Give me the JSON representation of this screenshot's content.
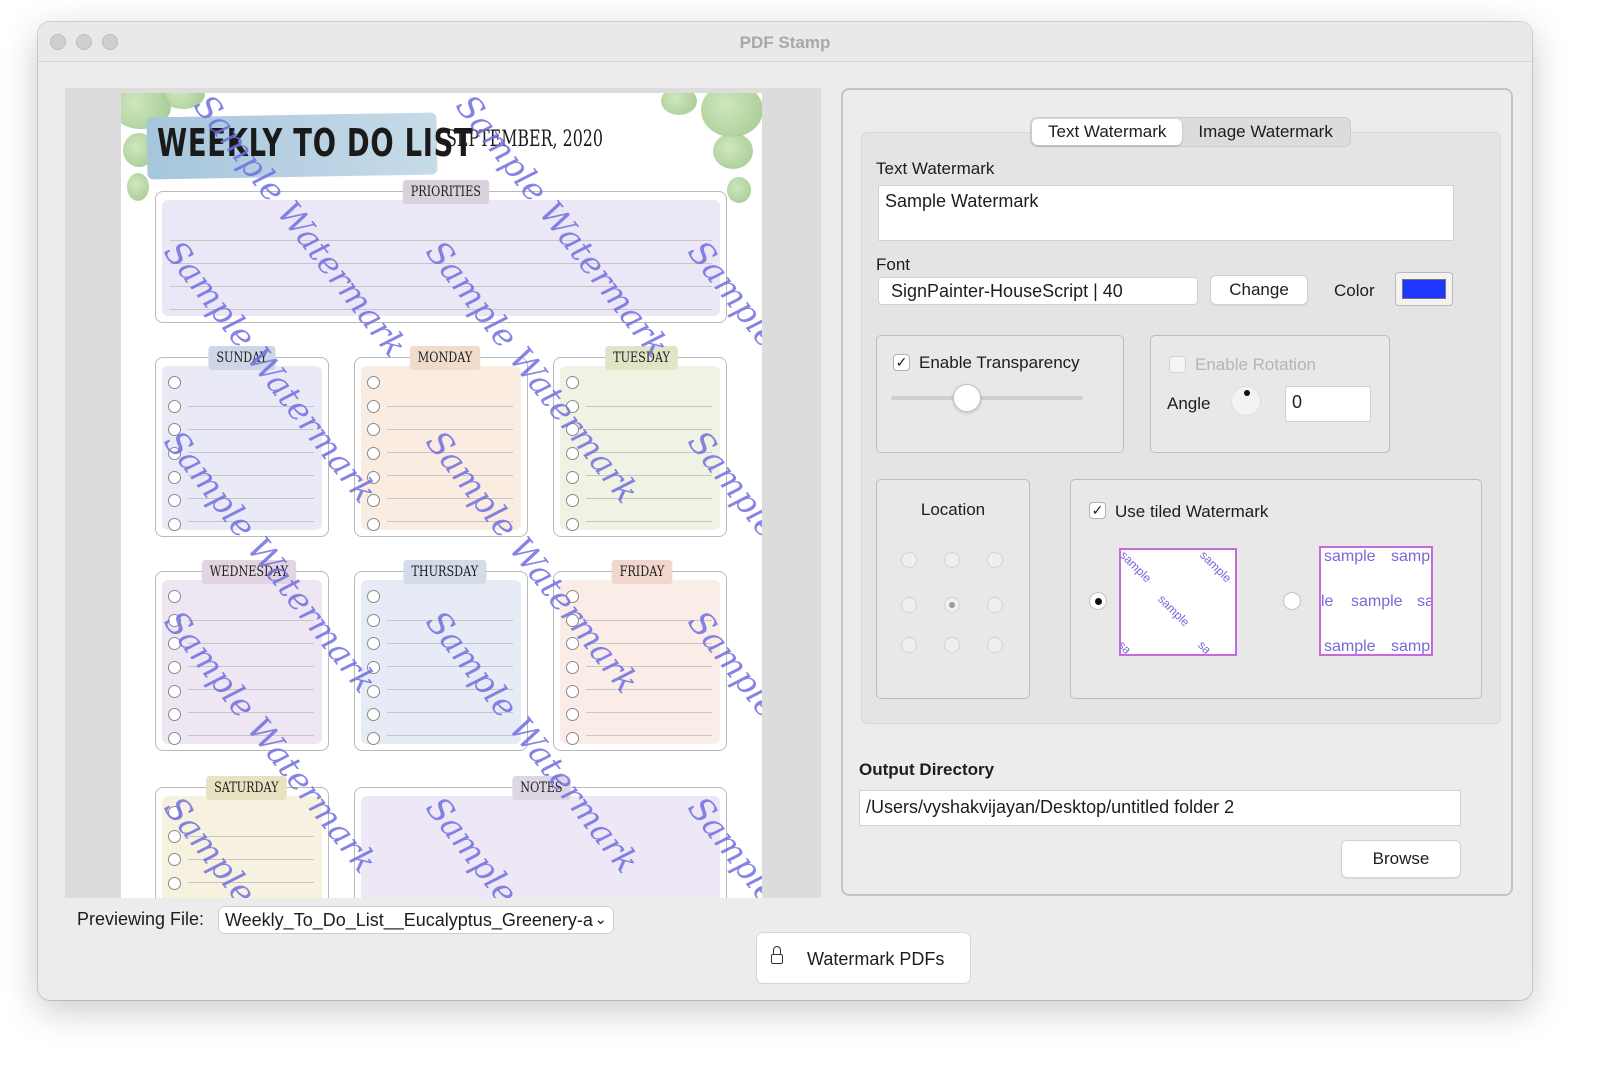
{
  "window": {
    "title": "PDF Stamp"
  },
  "preview": {
    "document": {
      "title": "WEEKLY TO DO LIST",
      "date": "SEPTEMBER, 2020",
      "sections": {
        "priorities": "PRIORITIES",
        "sunday": "SUNDAY",
        "monday": "MONDAY",
        "tuesday": "TUESDAY",
        "wednesday": "WEDNESDAY",
        "thursday": "THURSDAY",
        "friday": "FRIDAY",
        "saturday": "SATURDAY",
        "notes": "NOTES"
      },
      "watermark_text": "Sample Watermark",
      "watermark_color": "#6f6fe0"
    },
    "file_label": "Previewing File:",
    "file_selected": "Weekly_To_Do_List__Eucalyptus_Greenery-a"
  },
  "actions": {
    "watermark_button": "Watermark PDFs",
    "lock_icon": "lock-icon"
  },
  "tabs": {
    "text": "Text Watermark",
    "image": "Image Watermark",
    "active": "text"
  },
  "text_watermark": {
    "label": "Text Watermark",
    "value": "Sample Watermark"
  },
  "font": {
    "label": "Font",
    "value": "SignPainter-HouseScript | 40",
    "change_button": "Change",
    "color_label": "Color",
    "color": "#1f36ff"
  },
  "transparency": {
    "label": "Enable Transparency",
    "checked": true,
    "slider_value": 0.4
  },
  "rotation": {
    "label": "Enable Rotation",
    "checked": false,
    "enabled": false,
    "angle_label": "Angle",
    "angle_value": "0"
  },
  "location": {
    "label": "Location",
    "selected": "center"
  },
  "tiled": {
    "label": "Use tiled Watermark",
    "checked": true,
    "options": [
      {
        "id": "diagonal",
        "selected": true,
        "sample": "sample",
        "partials": [
          "sa",
          "sa"
        ]
      },
      {
        "id": "grid",
        "selected": false,
        "row1": [
          "sample",
          "samp"
        ],
        "row2": [
          "le",
          "sample",
          "sa"
        ],
        "row3": [
          "sample",
          "samp"
        ]
      }
    ]
  },
  "output": {
    "label": "Output Directory",
    "path": "/Users/vyshakvijayan/Desktop/untitled folder 2",
    "browse_button": "Browse"
  }
}
